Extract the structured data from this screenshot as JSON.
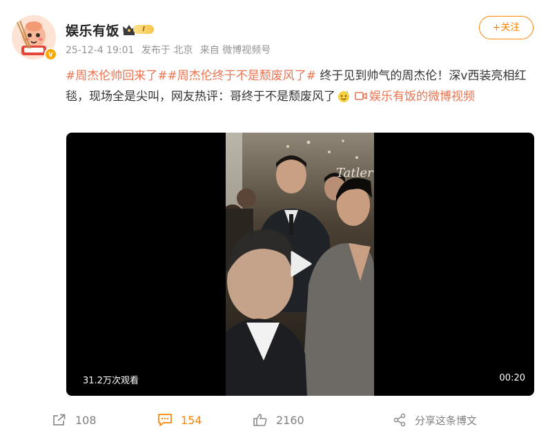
{
  "user": {
    "name": "娱乐有饭",
    "vip_level": "I",
    "verified_icon": "verified-badge-icon"
  },
  "meta": {
    "time": "25-12-4 19:01",
    "location": "发布于 北京",
    "source": "来自 微博视频号"
  },
  "follow_label": "+关注",
  "post": {
    "topic1": "#周杰伦帅回来了#",
    "topic2": "#周杰伦终于不是颓废风了#",
    "text1": " 终于见到帅气的周杰伦！深v西装亮相红毯，现场全是尖叫，网友热评：哥终于不是颓废风了",
    "video_link": "娱乐有饭的微博视频"
  },
  "video": {
    "views": "31.2万次观看",
    "duration": "00:20",
    "watermark": "Tatler"
  },
  "actions": {
    "repost_count": "108",
    "comment_count": "154",
    "like_count": "2160",
    "share_label": "分享这条博文"
  },
  "colors": {
    "accent": "#ff8200",
    "topic": "#eb7350",
    "meta": "#939393"
  }
}
